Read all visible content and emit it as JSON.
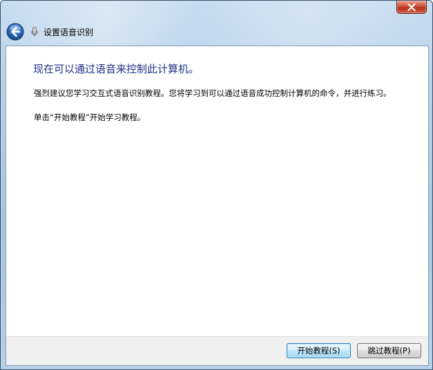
{
  "window": {
    "close_glyph": "✕"
  },
  "nav": {
    "title": "设置语音识别"
  },
  "content": {
    "heading": "现在可以通过语音来控制此计算机。",
    "paragraph1": "强烈建议您学习交互式语音识别教程。您将学习到可以通过语音成功控制计算机的命令，并进行练习。",
    "paragraph2": "单击“开始教程”开始学习教程。"
  },
  "footer": {
    "start_button": "开始教程(S)",
    "skip_button": "跳过教程(P)"
  },
  "colors": {
    "heading": "#1e3287",
    "frame": "#b6cfe7",
    "close_button": "#c8462d"
  }
}
